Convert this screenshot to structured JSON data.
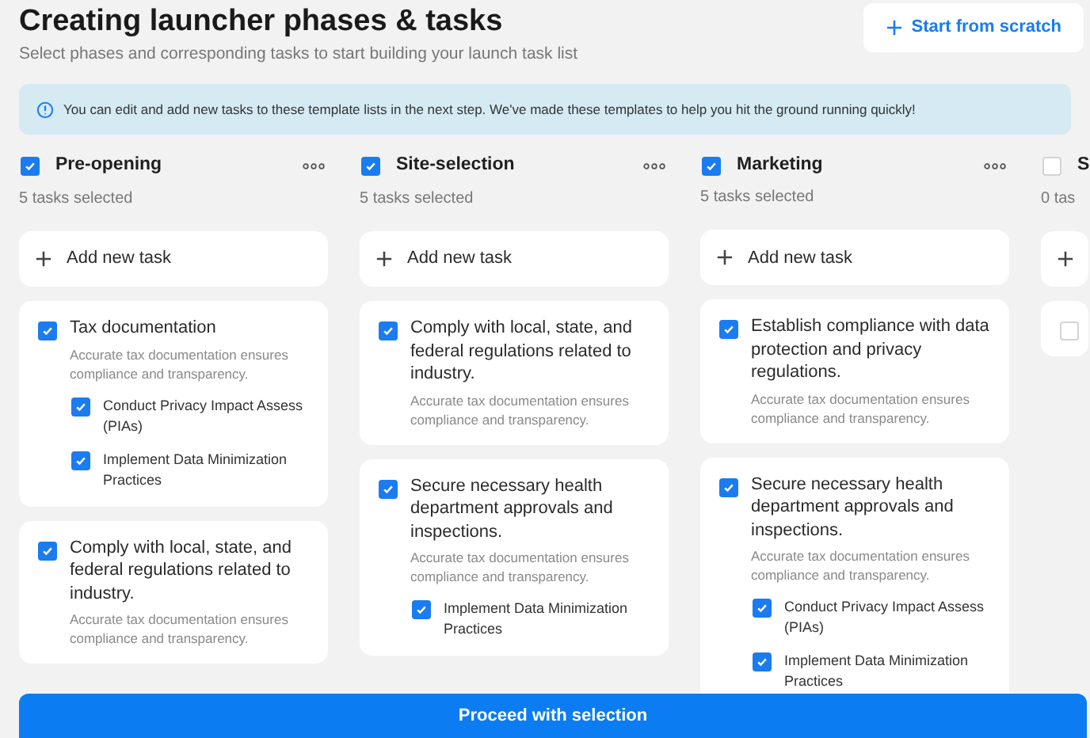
{
  "header": {
    "title": "Creating launcher phases & tasks",
    "subtitle": "Select phases and corresponding tasks to start building your launch task list",
    "action": "Start from scratch"
  },
  "info": "You can edit and add new tasks to these template lists in the next step. We've made these templates to help you hit the ground running quickly!",
  "columns": [
    {
      "title": "Pre-opening",
      "checked": true,
      "count": "5 tasks selected",
      "add_label": "Add new task",
      "tasks": [
        {
          "title": "Tax documentation",
          "checked": true,
          "description": "Accurate tax documentation ensures compliance and transparency.",
          "subtasks": [
            {
              "title": "Conduct Privacy Impact Assess (PIAs)",
              "checked": true
            },
            {
              "title": "Implement Data Minimization Practices",
              "checked": true
            }
          ]
        },
        {
          "title": "Comply with local, state, and federal regulations related to industry.",
          "checked": true,
          "description": "Accurate tax documentation ensures compliance and transparency."
        }
      ]
    },
    {
      "title": "Site-selection",
      "checked": true,
      "count": "5 tasks selected",
      "add_label": "Add new task",
      "tasks": [
        {
          "title": "Comply with local, state, and federal regulations related to industry.",
          "checked": true,
          "description": "Accurate tax documentation ensures compliance and transparency."
        },
        {
          "title": "Secure necessary health department approvals and inspections.",
          "checked": true,
          "description": "Accurate tax documentation ensures compliance and transparency.",
          "subtasks": [
            {
              "title": "Implement Data Minimization Practices",
              "checked": true
            }
          ]
        }
      ]
    },
    {
      "title": "Marketing",
      "checked": true,
      "count": "5 tasks selected",
      "add_label": "Add new task",
      "tasks": [
        {
          "title": "Establish compliance with data protection and privacy regulations.",
          "checked": true,
          "description": "Accurate tax documentation ensures compliance and transparency."
        },
        {
          "title": "Secure necessary health department approvals and inspections.",
          "checked": true,
          "description": "Accurate tax documentation ensures compliance and transparency.",
          "subtasks": [
            {
              "title": "Conduct Privacy Impact Assess (PIAs)",
              "checked": true
            },
            {
              "title": "Implement Data Minimization Practices",
              "checked": true
            }
          ]
        }
      ]
    },
    {
      "title": "S",
      "checked": false,
      "count": "0 tas",
      "tasks": [
        {
          "checked": false
        }
      ]
    }
  ],
  "proceed": "Proceed with selection"
}
